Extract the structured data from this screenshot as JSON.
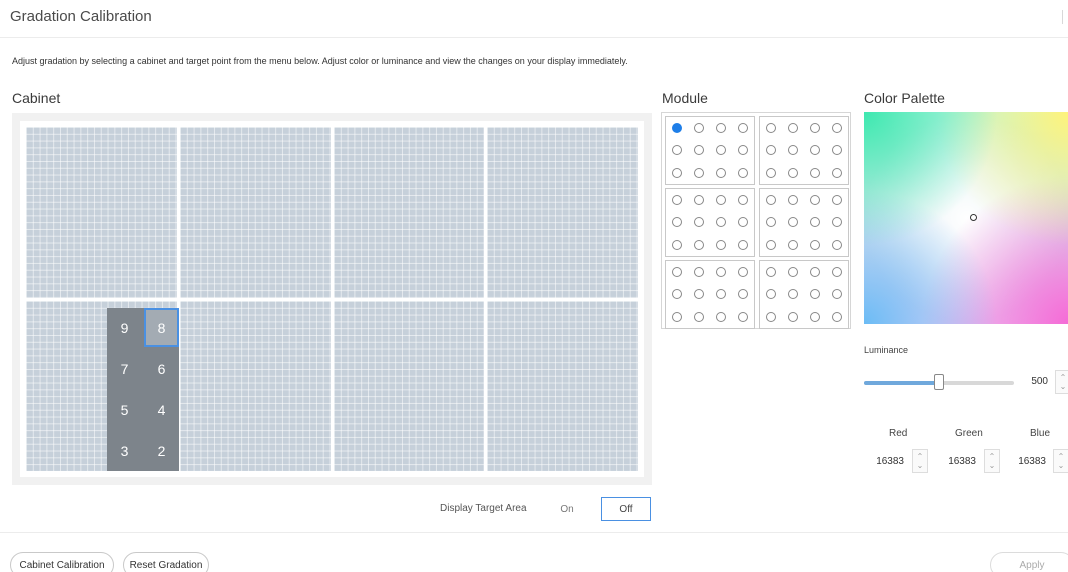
{
  "header": {
    "title": "Gradation Calibration"
  },
  "description": "Adjust gradation by selecting a cabinet and target point from the menu below. Adjust color or luminance and view the changes on your display immediately.",
  "cabinet": {
    "label": "Cabinet",
    "tiles": [
      "9",
      "8",
      "7",
      "6",
      "5",
      "4",
      "3",
      "2"
    ],
    "selected_tile": "8"
  },
  "module": {
    "label": "Module",
    "groups": 6,
    "selected_point": 1
  },
  "palette": {
    "label": "Color Palette",
    "luminance_label": "Luminance",
    "luminance_value": "500",
    "luminance_level": 0.5,
    "channels": [
      {
        "label": "Red",
        "value": "16383"
      },
      {
        "label": "Green",
        "value": "16383"
      },
      {
        "label": "Blue",
        "value": "16383"
      }
    ]
  },
  "display_target": {
    "label": "Display Target Area",
    "on_label": "On",
    "off_label": "Off",
    "selected": "Off"
  },
  "footer": {
    "cabinet_calibration": "Cabinet Calibration",
    "reset_gradation": "Reset Gradation",
    "apply": "Apply"
  },
  "colors": {
    "accent": "#4a90e2",
    "selected_dot": "#1e7ee8",
    "tile": "#7d848b",
    "panel": "#c6d0da"
  },
  "icons": {
    "spinner": "up-down-spinner-icon",
    "picker": "color-picker-circle-icon"
  }
}
